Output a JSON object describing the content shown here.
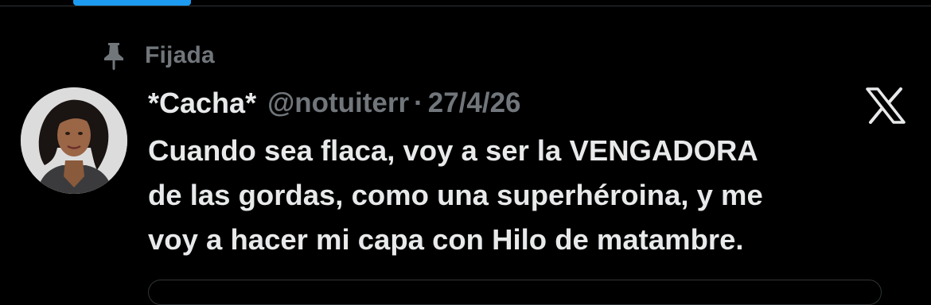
{
  "tabs": {
    "active_indicator_color": "#1d9bf0"
  },
  "pinned": {
    "label": "Fijada",
    "icon": "pin-icon"
  },
  "tweet": {
    "display_name": "*Cacha*",
    "handle": "@notuiterr",
    "separator": "·",
    "date": "27/4/26",
    "text_lines": [
      "Cuando sea flaca, voy a ser la VENGADORA",
      "de las gordas, como una superhéroina, y me",
      "voy a hacer mi capa con Hilo de matambre."
    ],
    "avatar_icon": "profile-avatar",
    "platform_icon": "x-logo-icon"
  },
  "colors": {
    "background": "#000000",
    "primary_text": "#e7e9ea",
    "secondary_text": "#71767b",
    "accent": "#1d9bf0"
  }
}
